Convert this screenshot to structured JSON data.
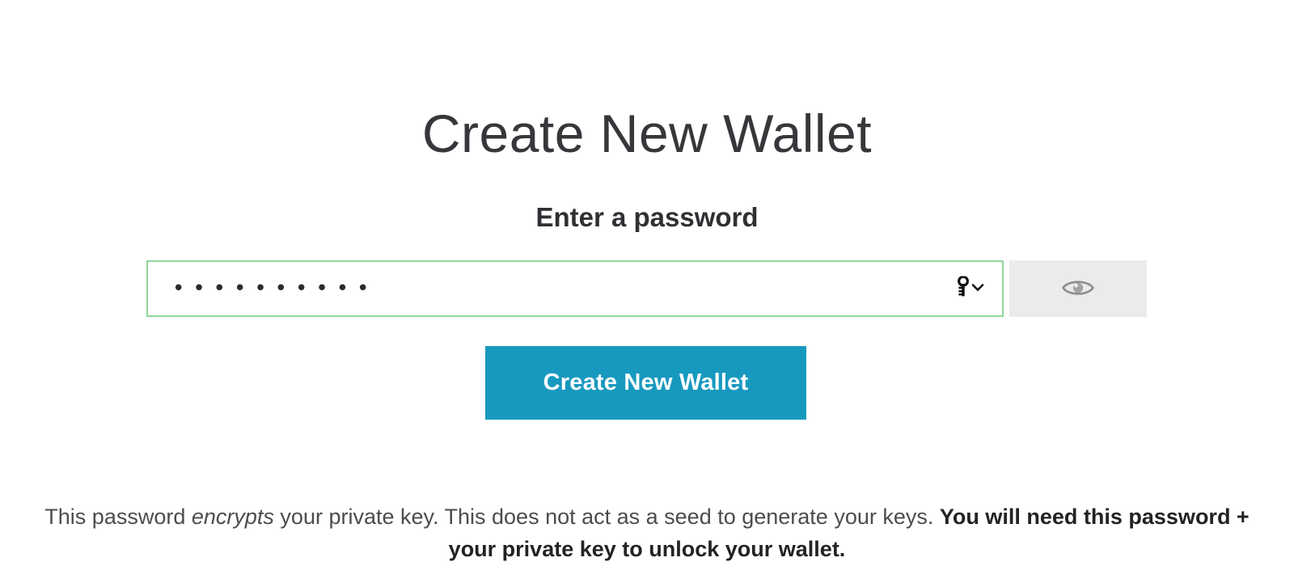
{
  "page": {
    "title": "Create New Wallet",
    "background_color": "#ffffff"
  },
  "form": {
    "label": "Enter a password",
    "password": {
      "value_masked": "••••••••••",
      "dot_count": 10,
      "placeholder": "",
      "border_color": "#8fd79c",
      "state": "valid",
      "autofill_icon": "key-icon",
      "autofill_chevron_icon": "chevron-down-icon"
    },
    "reveal_button": {
      "icon": "eye-icon",
      "background_color": "#ebebeb",
      "icon_color": "#8e8e8e"
    },
    "submit": {
      "label": "Create New Wallet",
      "background_color": "#1799bf",
      "text_color": "#ffffff"
    }
  },
  "footer": {
    "segments": [
      {
        "text": "This password ",
        "style": "normal"
      },
      {
        "text": "encrypts",
        "style": "italic"
      },
      {
        "text": " your private key. This does not act as a seed to generate your keys. ",
        "style": "normal"
      },
      {
        "text": "You will need this password + your private key to unlock your wallet.",
        "style": "bold"
      }
    ],
    "part1": "This password ",
    "part2_italic": "encrypts",
    "part3": " your private key. This does not act as a seed to generate your keys. ",
    "part4_bold": "You will need this password + your private key to unlock your wallet."
  }
}
